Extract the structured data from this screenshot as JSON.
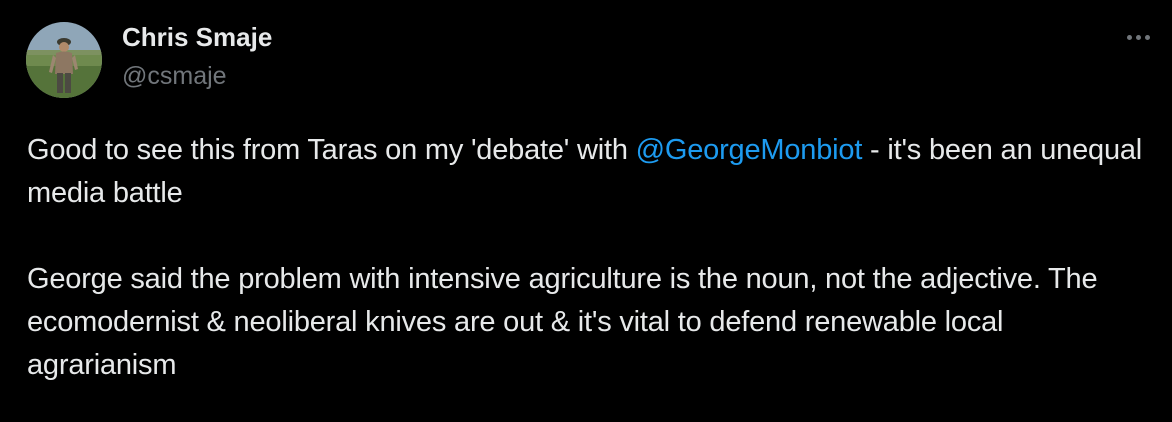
{
  "author": {
    "display_name": "Chris Smaje",
    "handle": "@csmaje",
    "avatar_icon": "profile-photo"
  },
  "more_icon": "more-dots-icon",
  "tweet": {
    "para1_before": "Good to see this from Taras on my 'debate' with ",
    "mention": "@GeorgeMonbiot",
    "para1_after": " - it's been an unequal media battle",
    "para2": "George said the problem with intensive agriculture is the noun, not the adjective. The ecomodernist & neoliberal knives are out & it's vital to defend renewable local agrarianism"
  },
  "colors": {
    "background": "#000000",
    "text": "#e7e9ea",
    "secondary": "#71767b",
    "link": "#1d9bf0"
  }
}
